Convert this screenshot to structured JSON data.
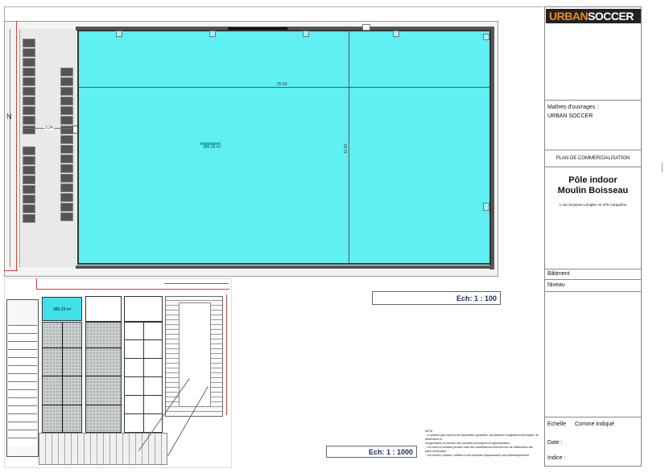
{
  "logo": {
    "part1": "URBAN",
    "part2": "SOCCER",
    "bg": "#f08a18"
  },
  "colors": {
    "field": "#5ef0f2",
    "field_small": "#3fe0ea",
    "scale_text": "#1a2a6a"
  },
  "plan": {
    "width_label": "25.60",
    "height_label": "11.06",
    "side_label": "3.24",
    "area_label": "385.23 m²"
  },
  "site": {
    "area_label": "385.23 m²"
  },
  "scales": {
    "main": "Ech: 1 : 100",
    "site": "Ech: 1 : 1000"
  },
  "notes": {
    "title": "NOTA",
    "lines": [
      "- Le présent plan reprend les dispositions générales, susceptibles d'adaptation techniques, de dimensions et",
      "d'organisation en fonction des nouvelles techniques et réglementaires.",
      "- Les cotes et surfaces peuvent subir des modifications mineures lors de l'élaboration des plans d'exécution.",
      "- Les poutres, poteaux, soffites et faux plafonds n'apparaissent pas systématiquement."
    ]
  },
  "cartouche": {
    "owner_label": "Maîtres d'ouvrages :",
    "owner_value": "URBAN SOCCER",
    "plan_type": "PLAN DE COMMERCIALISATION",
    "project_line1": "Pôle indoor",
    "project_line2": "Moulin Boisseau",
    "address": "1 rue Suzanne Lenglen 44 470 Carquefou",
    "batiment_label": "Bâtiment",
    "niveau_label": "Niveau",
    "echelle_label": "Echelle",
    "echelle_value": "Comme indiqué",
    "date_label": "Date :",
    "indice_label": "Indice :"
  },
  "north_mark": "N"
}
